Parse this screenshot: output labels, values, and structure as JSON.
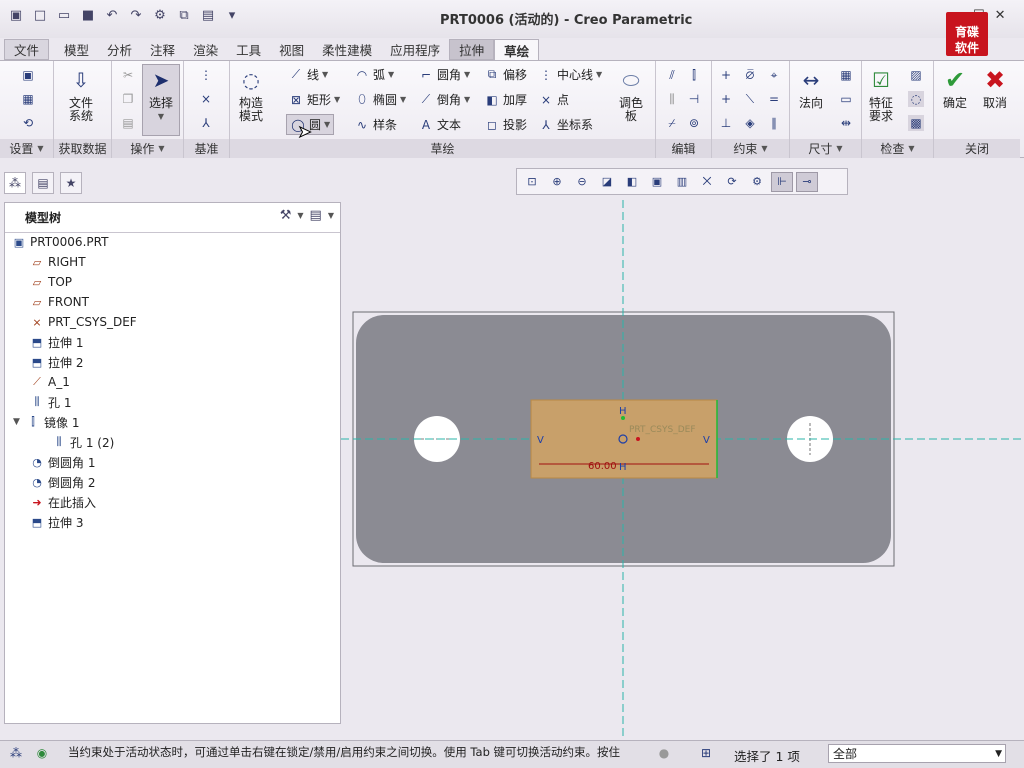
{
  "window": {
    "title": "PRT0006 (活动的) - Creo Parametric",
    "logo_line1": "育碟",
    "logo_line2": "软件"
  },
  "tabs": [
    "文件",
    "模型",
    "分析",
    "注释",
    "渲染",
    "工具",
    "视图",
    "柔性建模",
    "应用程序",
    "拉伸",
    "草绘"
  ],
  "ribbon": {
    "groups": [
      "设置",
      "获取数据",
      "操作",
      "基准",
      "草绘",
      "编辑",
      "约束",
      "尺寸",
      "检查",
      "关闭"
    ],
    "file_system": "文件\n系统",
    "select": "选择",
    "construct_mode": "构造\n模式",
    "palette": "调色\n板",
    "sketch_tools": {
      "line": "线",
      "arc": "弧",
      "fillet": "圆角",
      "offset": "偏移",
      "centerline": "中心线",
      "rect": "矩形",
      "ellipse": "椭圆",
      "chamfer": "倒角",
      "thicken": "加厚",
      "point": "点",
      "circle": "圆",
      "spline": "样条",
      "text": "文本",
      "project": "投影",
      "csys": "坐标系"
    },
    "normal": "法向",
    "feature_req": "特征\n要求",
    "ok": "确定",
    "cancel": "取消"
  },
  "model_tree": {
    "title": "模型树",
    "items": [
      "PRT0006.PRT",
      "RIGHT",
      "TOP",
      "FRONT",
      "PRT_CSYS_DEF",
      "拉伸 1",
      "拉伸 2",
      "A_1",
      "孔 1",
      "镜像 1",
      "孔 1 (2)",
      "倒圆角 1",
      "倒圆角 2",
      "在此插入",
      "拉伸 3"
    ]
  },
  "sketch": {
    "dimension": "60.00",
    "label_h": "H",
    "label_v": "V",
    "csys_label": "PRT_CSYS_DEF"
  },
  "status": {
    "message": "当约束处于活动状态时，可通过单击右键在锁定/禁用/启用约束之间切换。使用 Tab 键可切换活动约束。按住",
    "selected": "选择了 1 项",
    "filter": "全部"
  }
}
